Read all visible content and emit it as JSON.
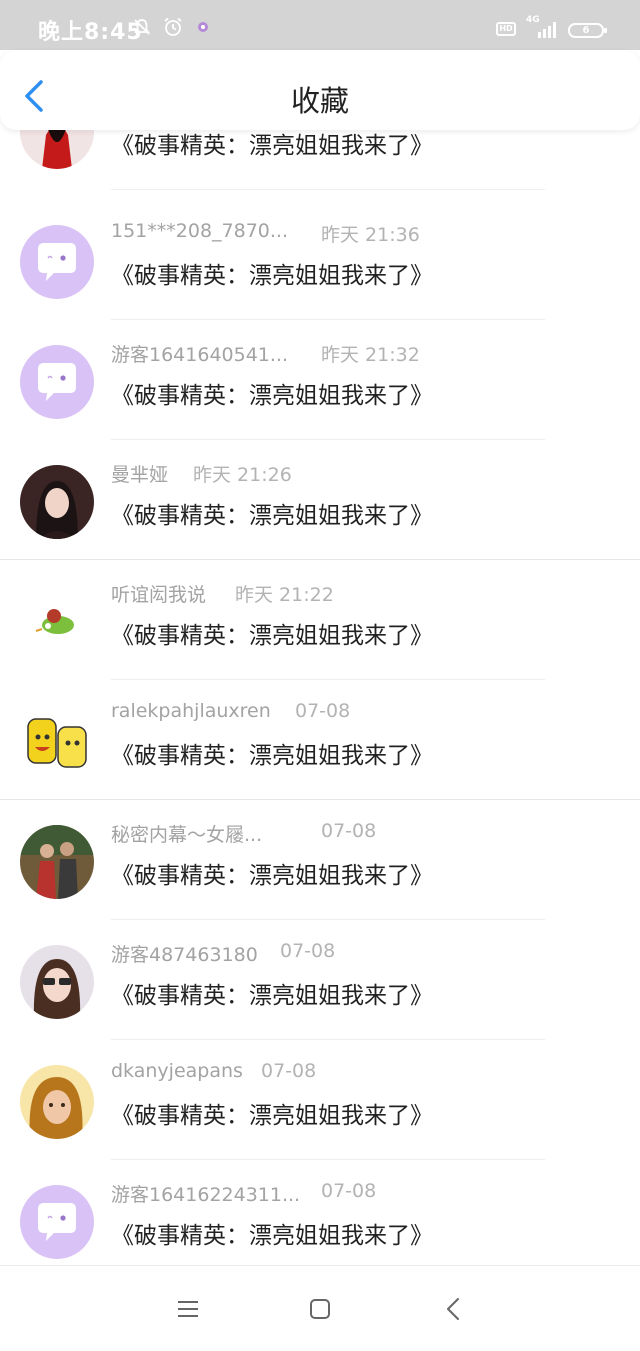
{
  "status_bar": {
    "time": "晚上8:45",
    "hd": "HD",
    "network": "4G",
    "battery": "6"
  },
  "header": {
    "title": "收藏"
  },
  "items": [
    {
      "name": "",
      "time": "",
      "content": "《破事精英：漂亮姐姐我来了》",
      "avatar": "girl-red-dress"
    },
    {
      "name": "151***208_7870...",
      "time": "昨天 21:36",
      "content": "《破事精英：漂亮姐姐我来了》",
      "avatar": "default-chat-bubble"
    },
    {
      "name": "游客1641640541...",
      "time": "昨天 21:32",
      "content": "《破事精英：漂亮姐姐我来了》",
      "avatar": "default-chat-bubble"
    },
    {
      "name": "曼芈娅",
      "time": "昨天 21:26",
      "content": "《破事精英：漂亮姐姐我来了》",
      "avatar": "woman-portrait"
    },
    {
      "name": "听谊闳我说",
      "time": "昨天 21:22",
      "content": "《破事精英：漂亮姐姐我来了》",
      "avatar": "green-bird-sticker"
    },
    {
      "name": "ralekpahjlauxren",
      "time": "07-08",
      "content": "《破事精英：漂亮姐姐我来了》",
      "avatar": "yellow-cartoon"
    },
    {
      "name": "秘密内幕～女屦...",
      "time": "07-08",
      "content": "《破事精英：漂亮姐姐我来了》",
      "avatar": "couple-photo"
    },
    {
      "name": "游客487463180",
      "time": "07-08",
      "content": "《破事精英：漂亮姐姐我来了》",
      "avatar": "girl-sunglasses"
    },
    {
      "name": "dkanyjeapans",
      "time": "07-08",
      "content": "《破事精英：漂亮姐姐我来了》",
      "avatar": "blonde-girl"
    },
    {
      "name": "游客16416224311...",
      "time": "07-08",
      "content": "《破事精英：漂亮姐姐我来了》",
      "avatar": "default-chat-bubble"
    }
  ],
  "nav_bar": {
    "icons": [
      "menu-icon",
      "home-icon",
      "back-icon"
    ]
  },
  "colors": {
    "accent": "#2d8ff0",
    "default_avatar": "#d9c2f5",
    "status_bar": "#d4d4d4"
  }
}
